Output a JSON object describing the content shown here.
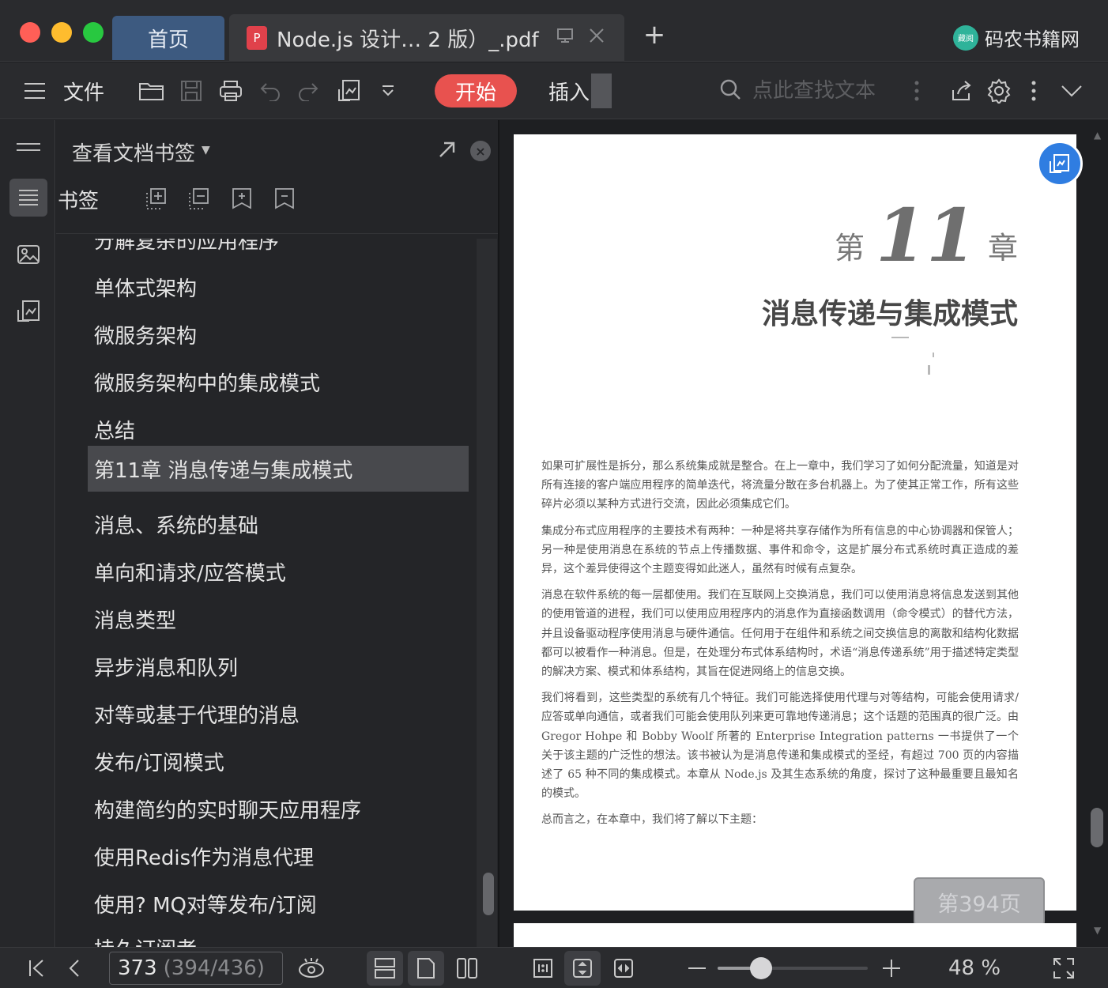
{
  "tabs": {
    "home": "首页",
    "document": "Node.js 设计… 2 版）_.pdf"
  },
  "brand": {
    "name": "码农书籍网",
    "logo_text": "藏阅"
  },
  "toolbar": {
    "menu_label": "文件",
    "start": "开始",
    "insert": "插入",
    "search_placeholder": "点此查找文本"
  },
  "panel": {
    "title": "查看文档书签",
    "bookmark_label": "书签"
  },
  "toc": [
    {
      "label": "分解复杂的应用程序",
      "selected": false
    },
    {
      "label": "单体式架构",
      "selected": false
    },
    {
      "label": "微服务架构",
      "selected": false
    },
    {
      "label": "微服务架构中的集成模式",
      "selected": false
    },
    {
      "label": "总结",
      "selected": false
    },
    {
      "label": "第11章 消息传递与集成模式",
      "selected": true
    },
    {
      "label": "消息、系统的基础",
      "selected": false
    },
    {
      "label": "单向和请求/应答模式",
      "selected": false
    },
    {
      "label": "消息类型",
      "selected": false
    },
    {
      "label": "异步消息和队列",
      "selected": false
    },
    {
      "label": "对等或基于代理的消息",
      "selected": false
    },
    {
      "label": "发布/订阅模式",
      "selected": false
    },
    {
      "label": "构建简约的实时聊天应用程序",
      "selected": false
    },
    {
      "label": "使用Redis作为消息代理",
      "selected": false
    },
    {
      "label": "使用? MQ对等发布/订阅",
      "selected": false
    },
    {
      "label": "持久订阅者",
      "selected": false
    }
  ],
  "document": {
    "chapter_prefix": "第",
    "chapter_number": "11",
    "chapter_suffix": "章",
    "chapter_title": "消息传递与集成模式",
    "paragraphs": [
      "如果可扩展性是拆分，那么系统集成就是整合。在上一章中，我们学习了如何分配流量，知道是对所有连接的客户端应用程序的简单迭代，将流量分散在多台机器上。为了使其正常工作，所有这些碎片必须以某种方式进行交流，因此必须集成它们。",
      "集成分布式应用程序的主要技术有两种：一种是将共享存储作为所有信息的中心协调器和保管人；另一种是使用消息在系统的节点上传播数据、事件和命令，这是扩展分布式系统时真正造成的差异，这个差异使得这个主题变得如此迷人，虽然有时候有点复杂。",
      "消息在软件系统的每一层都使用。我们在互联网上交换消息，我们可以使用消息将信息发送到其他的使用管道的进程，我们可以使用应用程序内的消息作为直接函数调用（命令模式）的替代方法，并且设备驱动程序使用消息与硬件通信。任何用于在组件和系统之间交换信息的离散和结构化数据都可以被看作一种消息。但是，在处理分布式体系结构时，术语“消息传递系统”用于描述特定类型的解决方案、模式和体系结构，其旨在促进网络上的信息交换。",
      "我们将看到，这些类型的系统有几个特征。我们可能选择使用代理与对等结构，可能会使用请求/应答或单向通信，或者我们可能会使用队列来更可靠地传递消息；这个话题的范围真的很广泛。由 Gregor Hohpe 和 Bobby Woolf 所著的 Enterprise Integration patterns 一书提供了一个关于该主题的广泛性的想法。该书被认为是消息传递和集成模式的圣经，有超过 700 页的内容描述了 65 种不同的集成模式。本章从 Node.js 及其生态系统的角度，探讨了这种最重要且最知名的模式。",
      "总而言之，在本章中，我们将了解以下主题："
    ],
    "page_indicator": "第394页"
  },
  "status": {
    "current_page": "373",
    "page_total": "(394/436)",
    "zoom": "48 %",
    "zoom_fraction": 0.29
  }
}
